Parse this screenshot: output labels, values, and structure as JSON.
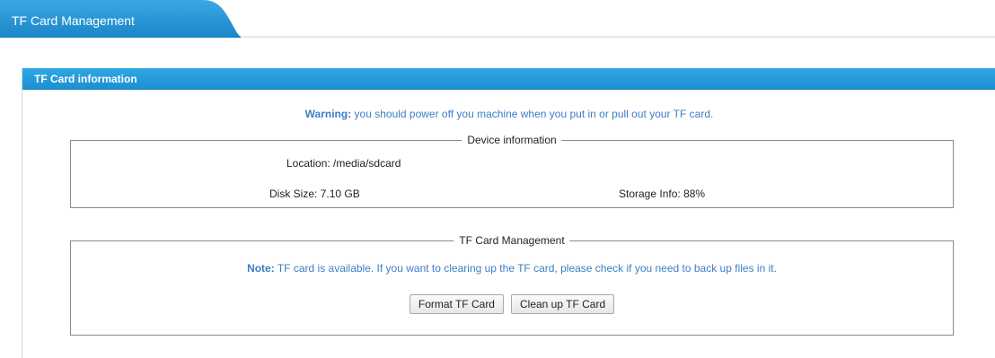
{
  "top_tab": {
    "label": "TF Card Management"
  },
  "colors": {
    "accent": "#1e8fd0",
    "link_text": "#3b7fc4",
    "border": "#8a8a8a"
  },
  "panel": {
    "title": "TF Card information"
  },
  "warning": {
    "strong": "Warning:",
    "text": " you should power off you machine when you put in or pull out your TF card."
  },
  "device_info": {
    "legend": "Device information",
    "location_label": "Location:",
    "location_value": "/media/sdcard",
    "disk_size_label": "Disk Size:",
    "disk_size_value": "7.10 GB",
    "storage_label": "Storage Info:",
    "storage_value": "88%"
  },
  "tf_management": {
    "legend": "TF Card Management",
    "note_strong": "Note:",
    "note_text": " TF card is available. If you want to clearing up the TF card, please check if you need to back up files in it.",
    "format_button": "Format TF Card",
    "cleanup_button": "Clean up TF Card"
  }
}
